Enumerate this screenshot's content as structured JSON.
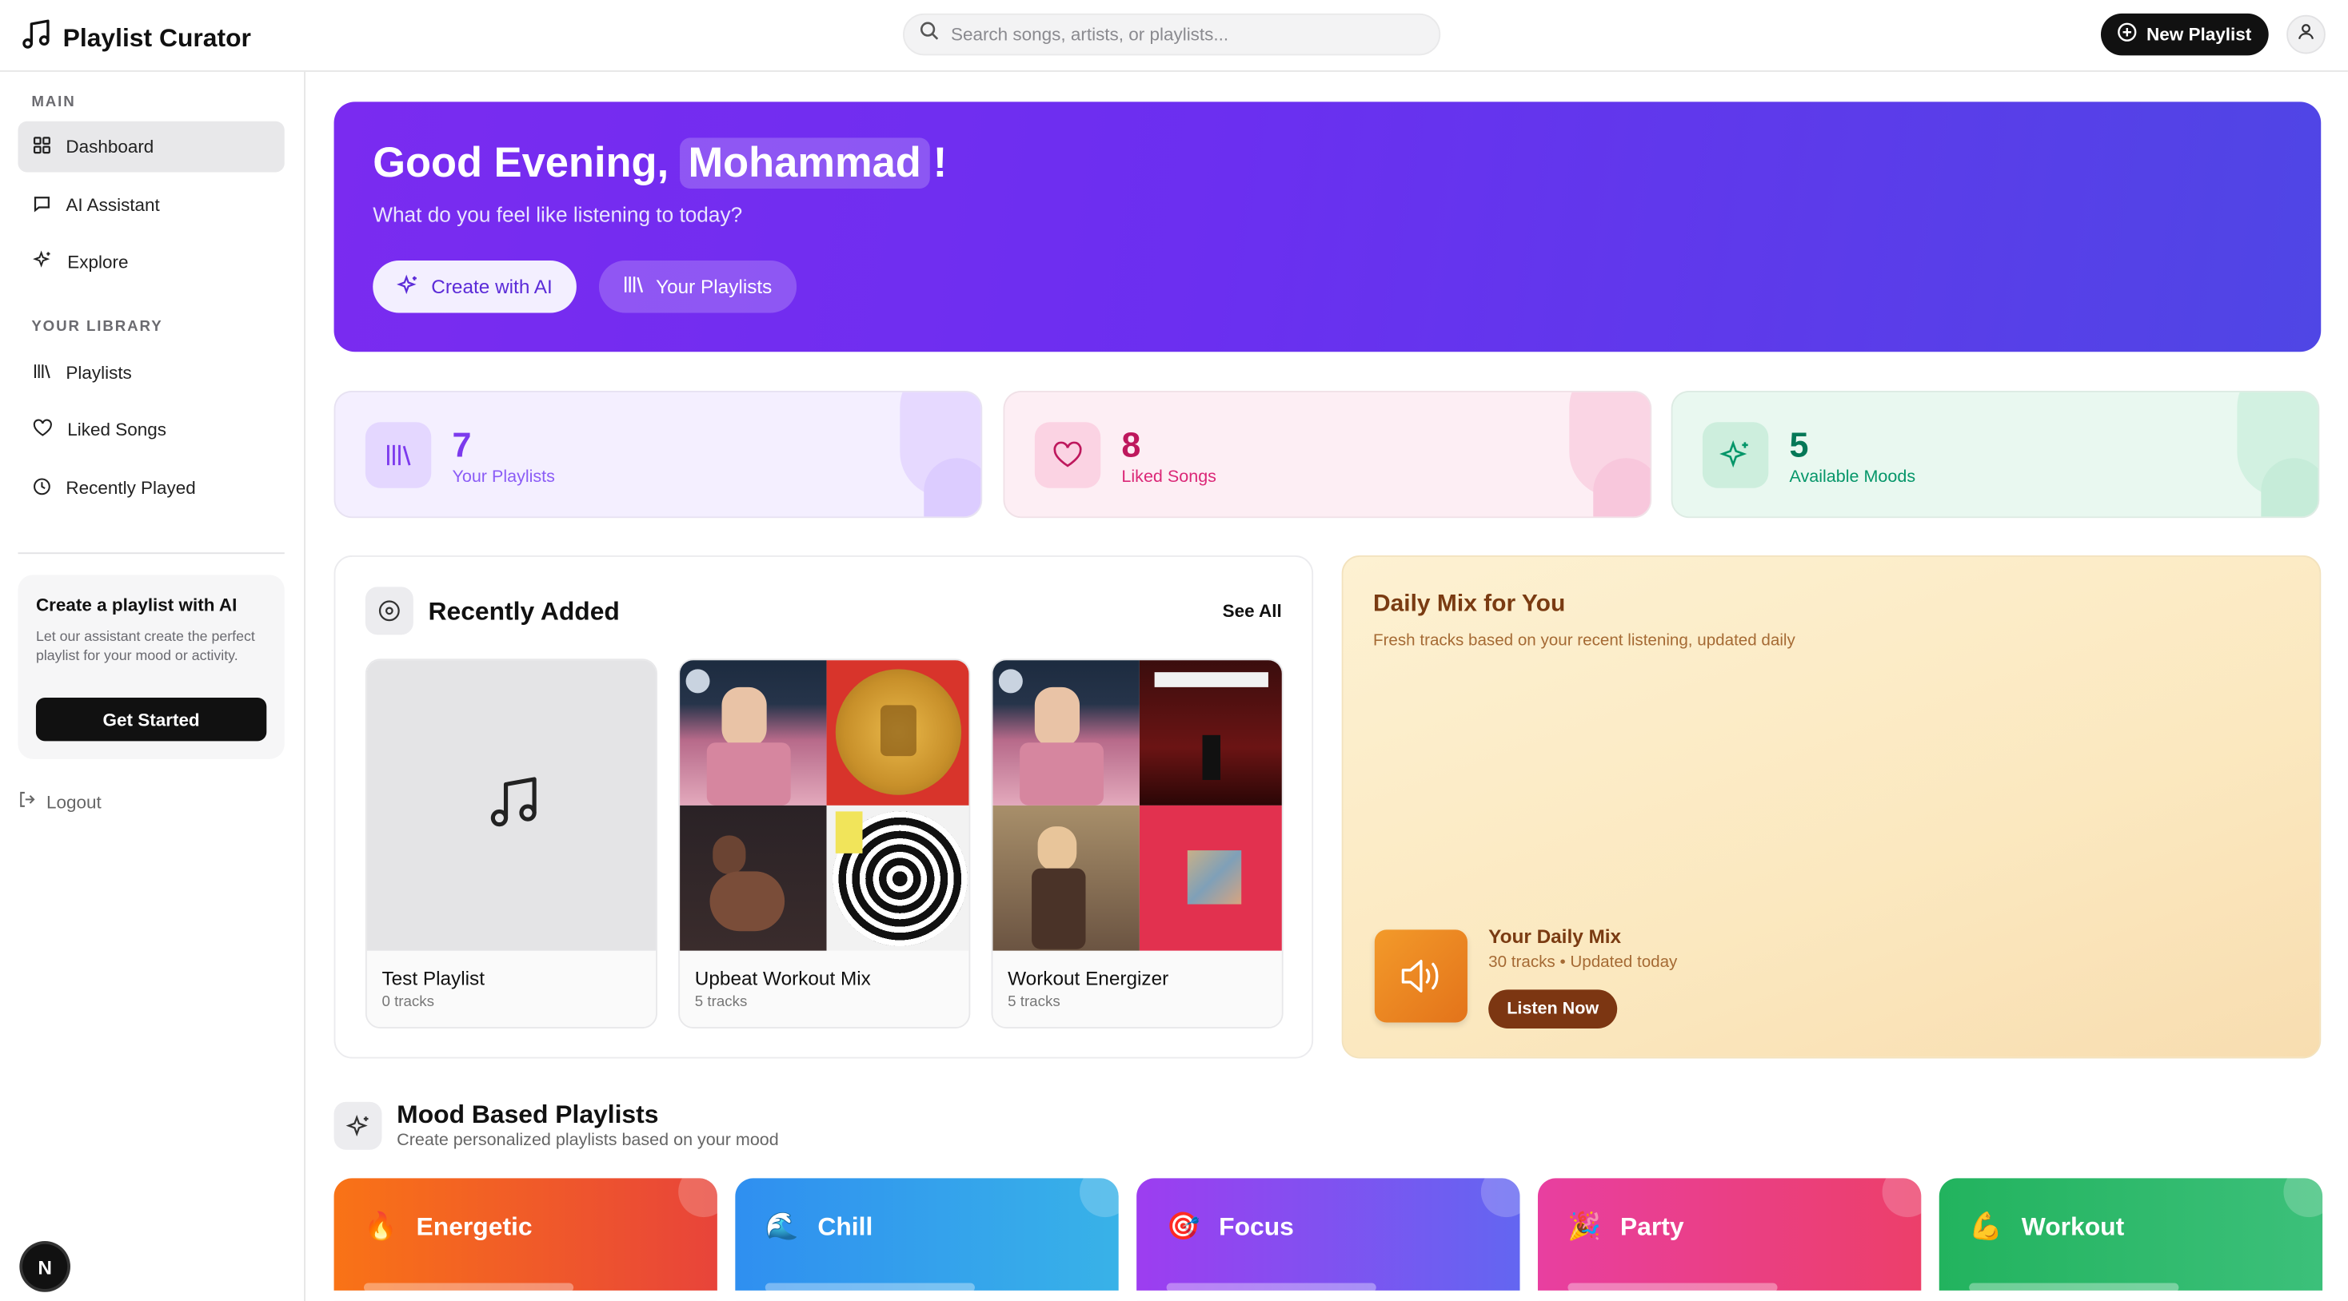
{
  "app": {
    "title": "Playlist Curator"
  },
  "header": {
    "search_placeholder": "Search songs, artists, or playlists...",
    "new_playlist_label": "New Playlist"
  },
  "sidebar": {
    "main_label": "MAIN",
    "main_items": [
      {
        "label": "Dashboard",
        "icon": "grid-icon",
        "active": true
      },
      {
        "label": "AI Assistant",
        "icon": "chat-icon",
        "active": false
      },
      {
        "label": "Explore",
        "icon": "sparkles-icon",
        "active": false
      }
    ],
    "library_label": "YOUR LIBRARY",
    "library_items": [
      {
        "label": "Playlists",
        "icon": "library-icon"
      },
      {
        "label": "Liked Songs",
        "icon": "heart-icon"
      },
      {
        "label": "Recently Played",
        "icon": "clock-icon"
      }
    ],
    "promo": {
      "title": "Create a playlist with AI",
      "text": "Let our assistant create the perfect playlist for your mood or activity.",
      "button": "Get Started"
    },
    "logout_label": "Logout",
    "badge_letter": "N"
  },
  "hero": {
    "greeting": "Good Evening,",
    "name": "Mohammad",
    "exclaim": "!",
    "subtitle": "What do you feel like listening to today?",
    "create_label": "Create with AI",
    "playlists_label": "Your Playlists"
  },
  "stats": [
    {
      "value": "7",
      "label": "Your Playlists",
      "color": "#7c3aed"
    },
    {
      "value": "8",
      "label": "Liked Songs",
      "color": "#be185d"
    },
    {
      "value": "5",
      "label": "Available Moods",
      "color": "#047857"
    }
  ],
  "recent": {
    "title": "Recently Added",
    "see_all": "See All",
    "cards": [
      {
        "title": "Test Playlist",
        "subtitle": "0 tracks"
      },
      {
        "title": "Upbeat Workout Mix",
        "subtitle": "5 tracks"
      },
      {
        "title": "Workout Energizer",
        "subtitle": "5 tracks"
      }
    ]
  },
  "daily": {
    "title": "Daily Mix for You",
    "subtitle": "Fresh tracks based on your recent listening, updated daily",
    "mix_title": "Your Daily Mix",
    "mix_meta": "30 tracks • Updated today",
    "listen_label": "Listen Now"
  },
  "mood": {
    "title": "Mood Based Playlists",
    "subtitle": "Create personalized playlists based on your mood",
    "items": [
      {
        "label": "Energetic",
        "emoji": "🔥"
      },
      {
        "label": "Chill",
        "emoji": "🌊"
      },
      {
        "label": "Focus",
        "emoji": "🎯"
      },
      {
        "label": "Party",
        "emoji": "🎉"
      },
      {
        "label": "Workout",
        "emoji": "💪"
      }
    ]
  },
  "colors": {
    "hero_start": "#7a2bf0",
    "hero_end": "#4f46e5",
    "accent_dark": "#111111"
  }
}
